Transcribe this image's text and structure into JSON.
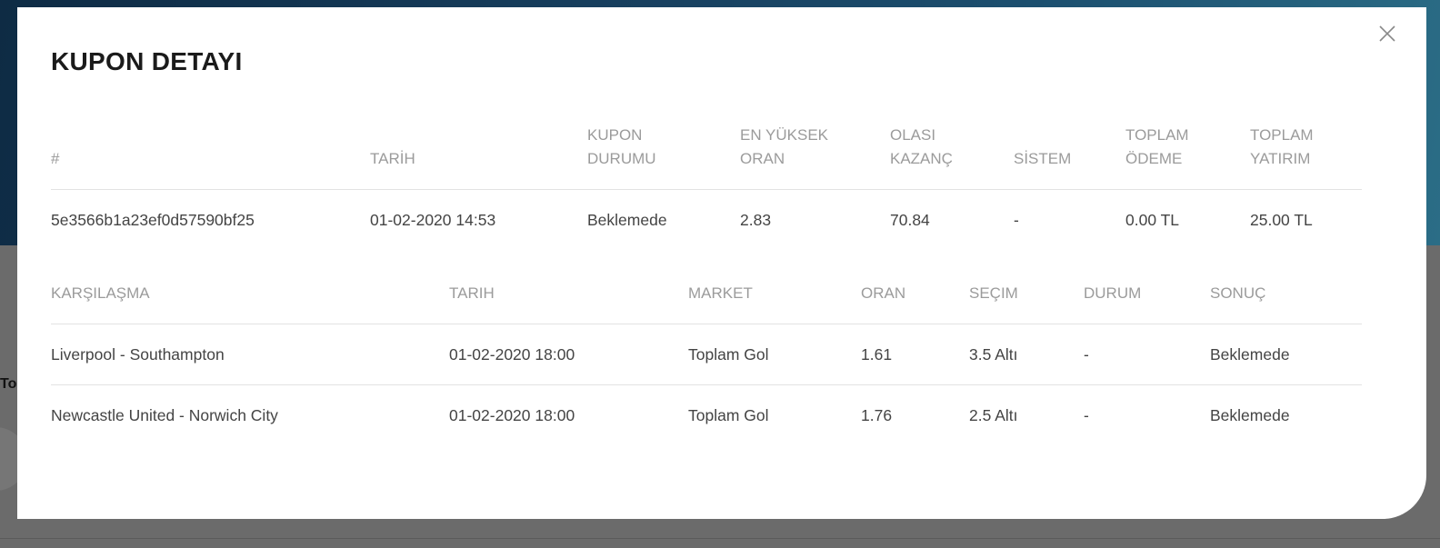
{
  "modal": {
    "title": "KUPON DETAYI",
    "close_icon": "close-icon"
  },
  "coupon_table": {
    "headers": [
      "#",
      "TARİH",
      "KUPON DURUMU",
      "EN YÜKSEK ORAN",
      "OLASI KAZANÇ",
      "SİSTEM",
      "TOPLAM ÖDEME",
      "TOPLAM YATIRIM"
    ],
    "row": {
      "id": "5e3566b1a23ef0d57590bf25",
      "date": "01-02-2020 14:53",
      "status": "Beklemede",
      "max_odds": "2.83",
      "potential_win": "70.84",
      "system": "-",
      "total_payment": "0.00 TL",
      "total_stake": "25.00 TL"
    }
  },
  "matches_table": {
    "headers": [
      "KARŞILAŞMA",
      "TARIH",
      "MARKET",
      "ORAN",
      "SEÇIM",
      "DURUM",
      "SONUÇ"
    ],
    "rows": [
      {
        "match": "Liverpool - Southampton",
        "date": "01-02-2020 18:00",
        "market": "Toplam Gol",
        "odds": "1.61",
        "selection": "3.5 Altı",
        "status": "-",
        "result": "Beklemede"
      },
      {
        "match": "Newcastle United - Norwich City",
        "date": "01-02-2020 18:00",
        "market": "Toplam Gol",
        "odds": "1.76",
        "selection": "2.5 Altı",
        "status": "-",
        "result": "Beklemede"
      }
    ]
  },
  "background": {
    "side_label": "To"
  }
}
